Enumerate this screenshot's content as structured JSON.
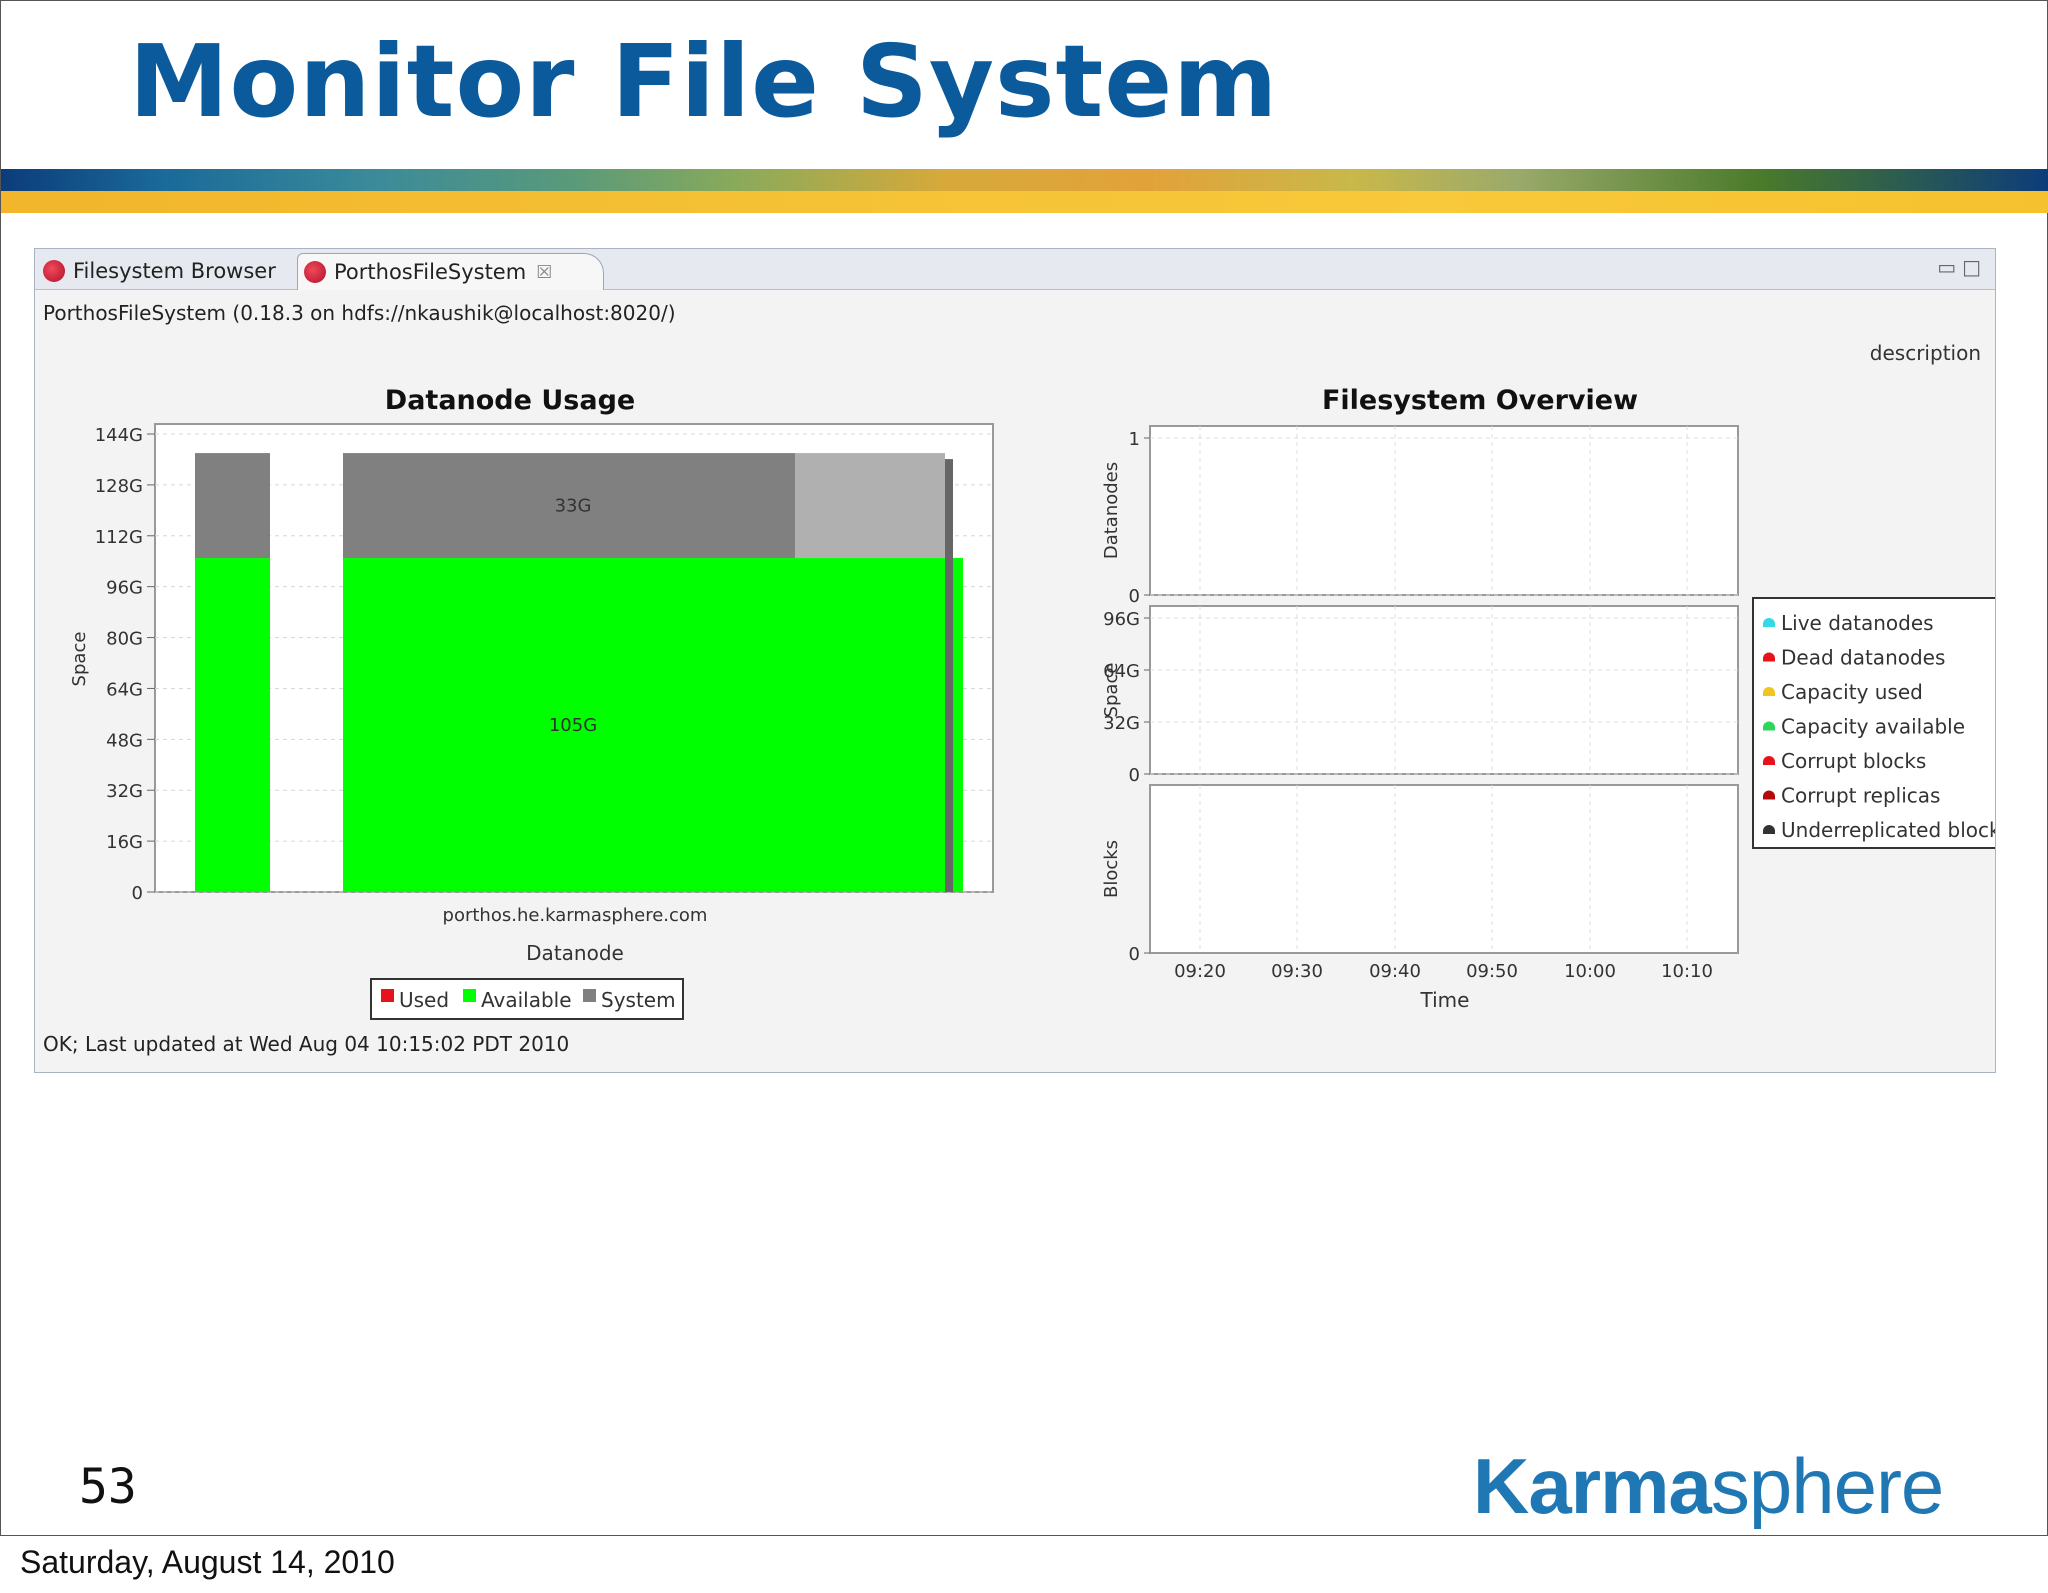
{
  "slide": {
    "title": "Monitor File System",
    "page_number": "53",
    "logo_text": "Karmasphere",
    "footer_date": "Saturday, August 14, 2010"
  },
  "tabs": [
    {
      "label": "Filesystem Browser",
      "active": false
    },
    {
      "label": "PorthosFileSystem",
      "active": true
    }
  ],
  "header": {
    "path_text": "PorthosFileSystem (0.18.3 on hdfs://nkaushik@localhost:8020/)",
    "description_label": "description"
  },
  "status_text": "OK; Last updated at Wed Aug 04 10:15:02 PDT 2010",
  "colors": {
    "used": "#e8121b",
    "available": "#00ff00",
    "system": "#808080",
    "live_datanodes": "#35d9e6",
    "dead_datanodes": "#e8121b",
    "capacity_used": "#f2c51e",
    "capacity_available": "#2ed65a",
    "corrupt_blocks": "#e8121b",
    "corrupt_replicas": "#b40a0a",
    "underreplicated_blocks": "#333333"
  },
  "chart_data": [
    {
      "type": "bar",
      "title": "Datanode Usage",
      "xlabel": "Datanode",
      "ylabel": "Space",
      "categories": [
        "porthos.he.karmasphere.com"
      ],
      "yticks": [
        "0",
        "16G",
        "32G",
        "48G",
        "64G",
        "80G",
        "96G",
        "112G",
        "128G",
        "144G"
      ],
      "ylim": [
        0,
        144
      ],
      "stacked": true,
      "series": [
        {
          "name": "Used",
          "values": [
            0
          ]
        },
        {
          "name": "Available",
          "values": [
            105
          ],
          "label": "105G"
        },
        {
          "name": "System",
          "values": [
            33
          ],
          "label": "33G"
        }
      ],
      "legend": "bottom"
    },
    {
      "type": "line",
      "title": "Filesystem Overview",
      "xlabel": "Time",
      "xticks": [
        "09:20",
        "09:30",
        "09:40",
        "09:50",
        "10:00",
        "10:10"
      ],
      "panels": [
        {
          "ylabel": "Datanodes",
          "yticks": [
            "0",
            "1"
          ]
        },
        {
          "ylabel": "Space",
          "yticks": [
            "0",
            "32G",
            "64G",
            "96G"
          ]
        },
        {
          "ylabel": "Blocks",
          "yticks": [
            "0"
          ]
        }
      ],
      "series": [
        {
          "name": "Live datanodes",
          "values": []
        },
        {
          "name": "Dead datanodes",
          "values": []
        },
        {
          "name": "Capacity used",
          "values": []
        },
        {
          "name": "Capacity available",
          "values": []
        },
        {
          "name": "Corrupt blocks",
          "values": []
        },
        {
          "name": "Corrupt replicas",
          "values": []
        },
        {
          "name": "Underreplicated blocks",
          "values": []
        }
      ],
      "legend": "right"
    }
  ]
}
